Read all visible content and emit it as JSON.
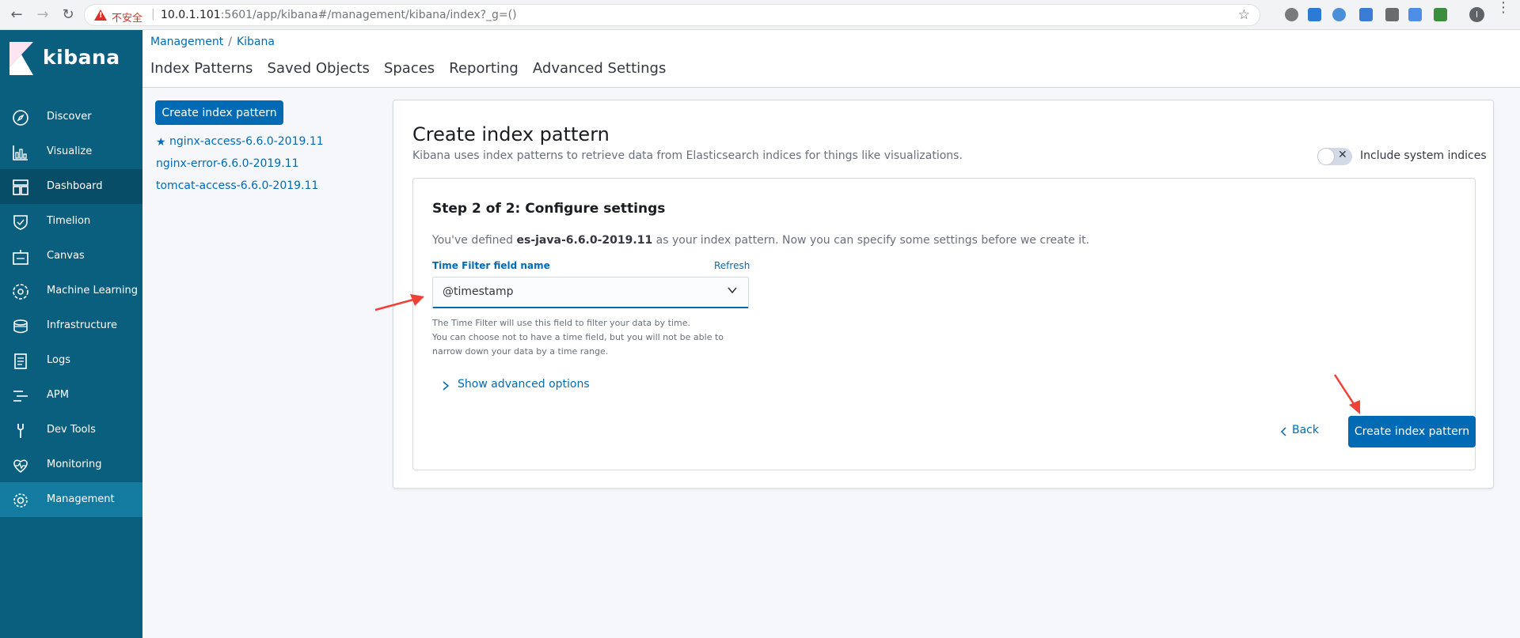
{
  "browser": {
    "insecure_label": "不安全",
    "url_host": "10.0.1.101",
    "url_rest": ":5601/app/kibana#/management/kibana/index?_g=()",
    "profile_initial": "I"
  },
  "sidebar": {
    "logo_text": "kibana",
    "items": [
      {
        "label": "Discover",
        "icon": "compass-icon"
      },
      {
        "label": "Visualize",
        "icon": "bar-chart-icon"
      },
      {
        "label": "Dashboard",
        "icon": "dashboard-icon"
      },
      {
        "label": "Timelion",
        "icon": "shield-icon"
      },
      {
        "label": "Canvas",
        "icon": "canvas-icon"
      },
      {
        "label": "Machine Learning",
        "icon": "ml-icon"
      },
      {
        "label": "Infrastructure",
        "icon": "infrastructure-icon"
      },
      {
        "label": "Logs",
        "icon": "logs-icon"
      },
      {
        "label": "APM",
        "icon": "apm-icon"
      },
      {
        "label": "Dev Tools",
        "icon": "wrench-icon"
      },
      {
        "label": "Monitoring",
        "icon": "heartbeat-icon"
      },
      {
        "label": "Management",
        "icon": "gear-icon"
      }
    ],
    "active_item": "Management"
  },
  "header": {
    "breadcrumb": [
      "Management",
      "Kibana"
    ],
    "tabs": [
      "Index Patterns",
      "Saved Objects",
      "Spaces",
      "Reporting",
      "Advanced Settings"
    ]
  },
  "left": {
    "create_button": "Create index pattern",
    "index_patterns": [
      "nginx-access-6.6.0-2019.11",
      "nginx-error-6.6.0-2019.11",
      "tomcat-access-6.6.0-2019.11"
    ]
  },
  "panel": {
    "title": "Create index pattern",
    "description": "Kibana uses index patterns to retrieve data from Elasticsearch indices for things like visualizations.",
    "include_system_label": "Include system indices",
    "step_title": "Step 2 of 2: Configure settings",
    "defined_prefix": "You've defined ",
    "defined_pattern": "es-java-6.6.0-2019.11",
    "defined_suffix": " as your index pattern. Now you can specify some settings before we create it.",
    "field_label": "Time Filter field name",
    "refresh_label": "Refresh",
    "selected_field": "@timestamp",
    "help_lines": [
      "The Time Filter will use this field to filter your data by time.",
      "You can choose not to have a time field, but you will not be able to",
      "narrow down your data by a time range."
    ],
    "advanced_label": "Show advanced options",
    "back_label": "Back",
    "create_label": "Create index pattern"
  },
  "colors": {
    "sidebar": "#0a5f7f",
    "primary": "#006bb4",
    "annotation": "#ef4135"
  }
}
